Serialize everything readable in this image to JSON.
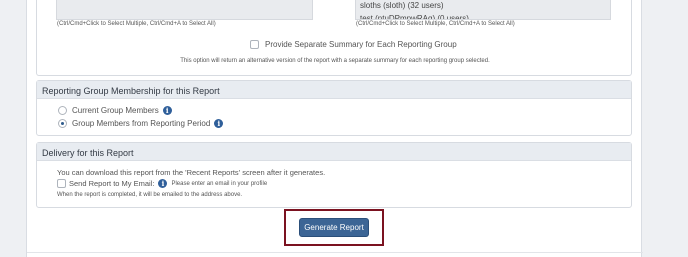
{
  "reporting_groups": {
    "left_list_options": [],
    "right_list_options": [
      "sloths (sloth) (32 users)",
      "test (ntuDPmpwRAq) (0 users)"
    ],
    "multi_select_hint": "(Ctrl/Cmd+Click to Select Multiple, Ctrl/Cmd+A to Select All)",
    "separate_summary_label": "Provide Separate Summary for Each Reporting Group",
    "separate_summary_note": "This option will return an alternative version of the report with a separate summary for each reporting group selected."
  },
  "membership": {
    "title": "Reporting Group Membership for this Report",
    "options": [
      {
        "label": "Current Group Members",
        "selected": false
      },
      {
        "label": "Group Members from Reporting Period",
        "selected": true
      }
    ]
  },
  "delivery": {
    "title": "Delivery for this Report",
    "download_text": "You can download this report from the 'Recent Reports' screen after it generates.",
    "email_label": "Send Report to My Email:",
    "email_warning": "Please enter an email in your profile",
    "completed_note": "When the report is completed, it will be emailed to the address above."
  },
  "actions": {
    "generate_label": "Generate Report"
  },
  "colors": {
    "primary_button": "#3c6595",
    "highlight_border": "#7b1220",
    "info_icon": "#2f5f9a"
  }
}
